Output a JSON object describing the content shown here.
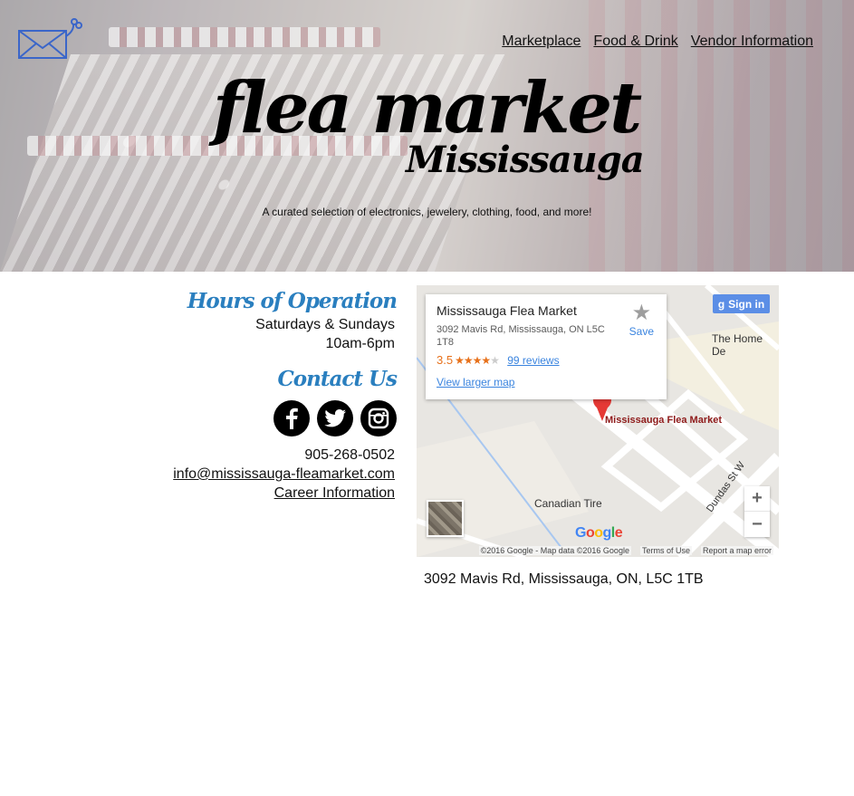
{
  "nav": {
    "items": [
      {
        "label": "Marketplace"
      },
      {
        "label": "Food & Drink"
      },
      {
        "label": "Vendor Information"
      }
    ]
  },
  "brand": {
    "title": "flea market",
    "subtitle": "Mississauga",
    "tagline": "A curated selection of electronics, jewelery, clothing, food, and more!"
  },
  "hours": {
    "heading": "Hours of Operation",
    "days": "Saturdays & Sundays",
    "time": "10am-6pm"
  },
  "contact": {
    "heading": "Contact Us",
    "social_icons": [
      "facebook-icon",
      "twitter-icon",
      "instagram-icon"
    ],
    "phone": "905-268-0502",
    "email": "info@mississauga-fleamarket.com",
    "career": "Career Information"
  },
  "map": {
    "place_name": "Mississauga Flea Market",
    "place_address": "3092 Mavis Rd, Mississauga, ON L5C 1T8",
    "rating": "3.5",
    "reviews": "99 reviews",
    "view_larger": "View larger map",
    "save_label": "Save",
    "signin_label": "Sign in",
    "label_home_depot": "The Home De",
    "label_canadian_tire": "Canadian Tire",
    "label_street": "Dundas St W",
    "pin_label": "Mississauga Flea Market",
    "footer_copyright": "©2016 Google - Map data ©2016 Google",
    "footer_terms": "Terms of Use",
    "footer_report": "Report a map error",
    "google_logo": "Google",
    "colors": {
      "accent_blue": "#3a84df",
      "pin_red": "#e53935",
      "rating_orange": "#e7711b"
    }
  },
  "address": "3092 Mavis Rd, Mississauga, ON, L5C 1TB",
  "colors": {
    "heading_blue": "#2a7fbf",
    "logo_blue": "#3b66c9"
  }
}
